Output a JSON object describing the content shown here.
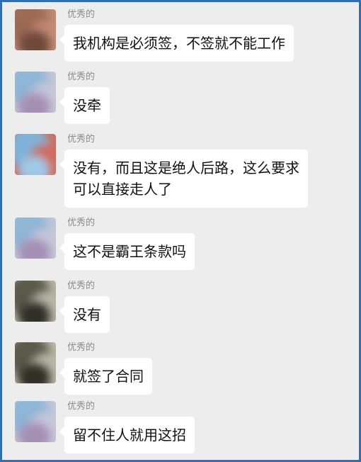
{
  "messages": [
    {
      "sender": "优秀的",
      "text": "我机构是必须签，不签就不能工作",
      "avatar": {
        "colors": [
          "#9c6a55",
          "#c58b76",
          "#6e4a3b"
        ]
      }
    },
    {
      "sender": "优秀的",
      "text": "没牵",
      "avatar": {
        "colors": [
          "#8fb6d6",
          "#c7c7d8",
          "#a58fb5"
        ]
      }
    },
    {
      "sender": "优秀的",
      "text": "没有，而且这是绝人后路，这么要求可以直接走人了",
      "avatar": {
        "colors": [
          "#7fb3d9",
          "#d46a5e",
          "#9fc8e8"
        ]
      }
    },
    {
      "sender": "优秀的",
      "text": "这不是霸王条款吗",
      "avatar": {
        "colors": [
          "#8fb6d6",
          "#c7c7d8",
          "#a58fb5"
        ]
      }
    },
    {
      "sender": "优秀的",
      "text": "没有",
      "avatar": {
        "colors": [
          "#5a5a4a",
          "#b9b7a8",
          "#2f2f28"
        ]
      }
    },
    {
      "sender": "优秀的",
      "text": "就签了合同",
      "avatar": {
        "colors": [
          "#5a5a4a",
          "#b9b7a8",
          "#2f2f28"
        ]
      }
    },
    {
      "sender": "优秀的",
      "text": "留不住人就用这招",
      "avatar": {
        "colors": [
          "#8fb6d6",
          "#c7c7d8",
          "#a58fb5"
        ]
      }
    }
  ]
}
